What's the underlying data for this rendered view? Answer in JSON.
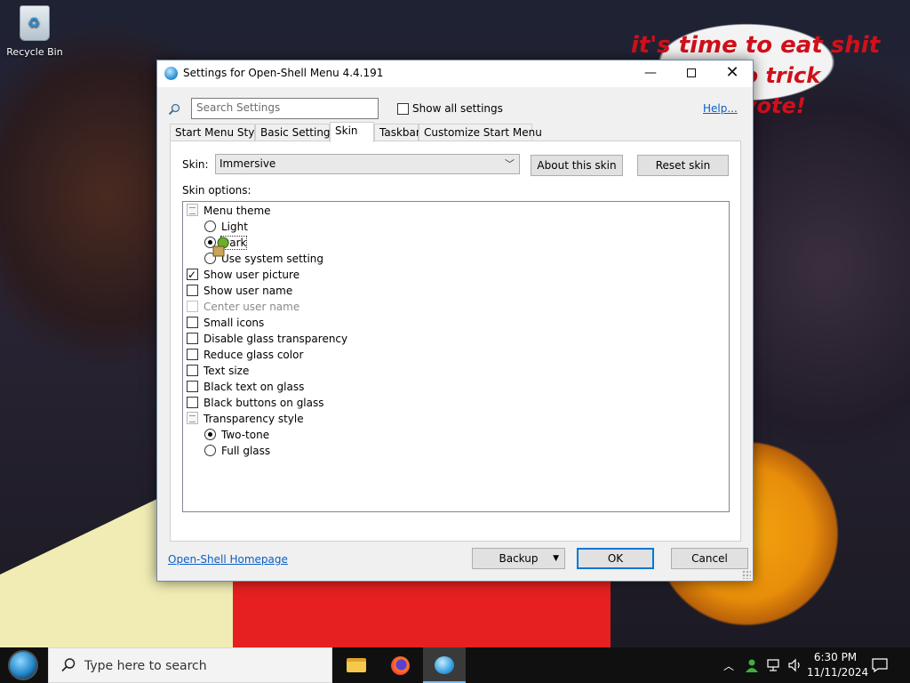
{
  "desktop": {
    "recycle_bin_label": "Recycle Bin",
    "wallpaper_caption_line1": "it's time to eat shit",
    "wallpaper_caption_line2": "nd go trick",
    "wallpaper_caption_line3": "nd vote!"
  },
  "window": {
    "title": "Settings for Open-Shell Menu 4.4.191",
    "search": {
      "placeholder": "Search Settings",
      "value": ""
    },
    "show_all_label": "Show all settings",
    "show_all_checked": false,
    "help_link": "Help...",
    "tabs": [
      {
        "label": "Start Menu Style",
        "active": false
      },
      {
        "label": "Basic Settings",
        "active": false
      },
      {
        "label": "Skin",
        "active": true
      },
      {
        "label": "Taskbar",
        "active": false
      },
      {
        "label": "Customize Start Menu",
        "active": false
      }
    ],
    "skin": {
      "label": "Skin:",
      "selected": "Immersive",
      "about_button": "About this skin",
      "reset_button": "Reset skin",
      "options_label": "Skin options:"
    },
    "options": [
      {
        "type": "group",
        "label": "Menu theme"
      },
      {
        "type": "radio",
        "label": "Light",
        "checked": false,
        "indent": 1
      },
      {
        "type": "radio",
        "label": "Dark",
        "checked": true,
        "indent": 1
      },
      {
        "type": "radio",
        "label": "Use system setting",
        "checked": false,
        "indent": 1
      },
      {
        "type": "checkbox",
        "label": "Show user picture",
        "checked": true
      },
      {
        "type": "checkbox",
        "label": "Show user name",
        "checked": false
      },
      {
        "type": "checkbox",
        "label": "Center user name",
        "checked": false,
        "disabled": true
      },
      {
        "type": "checkbox",
        "label": "Small icons",
        "checked": false
      },
      {
        "type": "checkbox",
        "label": "Disable glass transparency",
        "checked": false
      },
      {
        "type": "checkbox",
        "label": "Reduce glass color",
        "checked": false
      },
      {
        "type": "checkbox",
        "label": "Text size",
        "checked": false
      },
      {
        "type": "checkbox",
        "label": "Black text on glass",
        "checked": false
      },
      {
        "type": "checkbox",
        "label": "Black buttons on glass",
        "checked": false
      },
      {
        "type": "group",
        "label": "Transparency style"
      },
      {
        "type": "radio",
        "label": "Two-tone",
        "checked": true,
        "indent": 1
      },
      {
        "type": "radio",
        "label": "Full glass",
        "checked": false,
        "indent": 1
      }
    ],
    "homepage_link": "Open-Shell Homepage",
    "backup_button": "Backup",
    "ok_button": "OK",
    "cancel_button": "Cancel"
  },
  "taskbar": {
    "search_placeholder": "Type here to search",
    "apps": [
      "file-explorer-icon",
      "firefox-icon",
      "open-shell-icon"
    ],
    "clock_time": "6:30 PM",
    "clock_date": "11/11/2024"
  },
  "colors": {
    "accent": "#0078d7",
    "link": "#0a5ec7",
    "taskbar": "#101010"
  }
}
